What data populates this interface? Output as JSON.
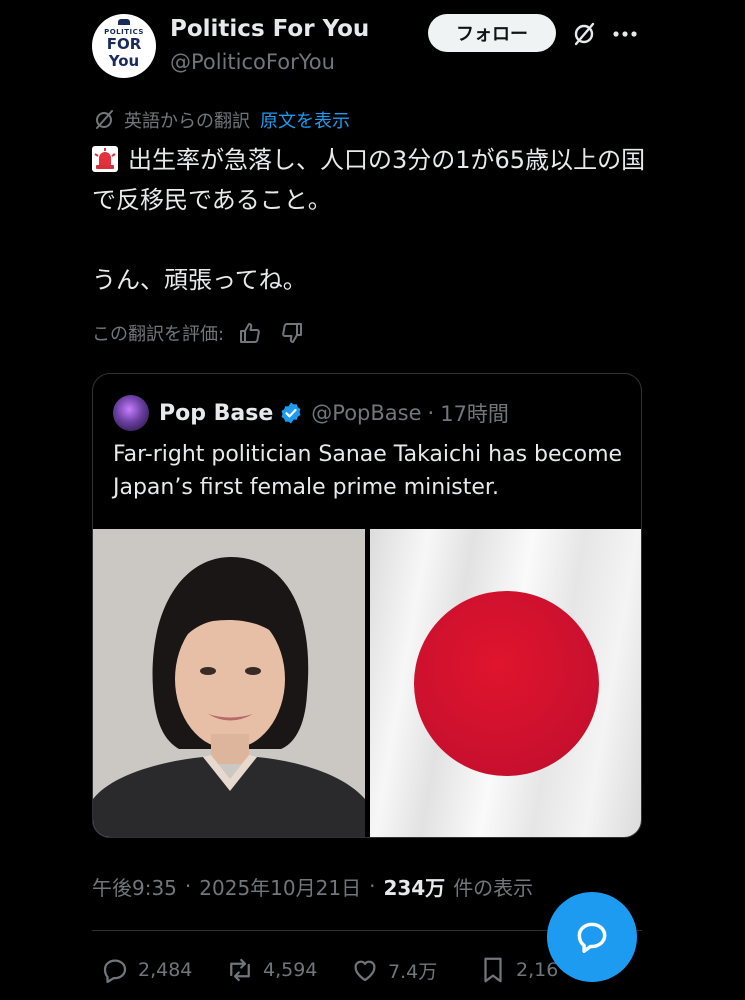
{
  "author": {
    "display_name": "Politics For You",
    "handle": "@PoliticoForYou",
    "avatar_text_small": "POLITICS",
    "avatar_text_line1": "FOR",
    "avatar_text_line2": "You"
  },
  "header": {
    "follow_label": "フォロー"
  },
  "translation": {
    "label": "英語からの翻訳",
    "show_original": "原文を表示",
    "rate_label": "この翻訳を評価:"
  },
  "tweet": {
    "line1": "出生率が急落し、人口の3分の1が65歳以上の国で反移民であること。",
    "line2": "うん、頑張ってね。"
  },
  "quote": {
    "name": "Pop Base",
    "handle": "@PopBase",
    "separator": "·",
    "time": "17時間",
    "text": "Far-right politician Sanae Takaichi has become Japan’s first female prime minister."
  },
  "meta": {
    "time": "午後9:35",
    "date": "2025年10月21日",
    "views": "234万",
    "views_label": "件の表示",
    "dot": "·"
  },
  "actions": {
    "replies": "2,484",
    "reposts": "4,594",
    "likes": "7.4万",
    "bookmarks": "2,16"
  },
  "colors": {
    "background": "#000000",
    "accent": "#1d9bf0",
    "text_primary": "#e7e9ea",
    "text_secondary": "#71767b",
    "flag_red": "#c8102e"
  }
}
